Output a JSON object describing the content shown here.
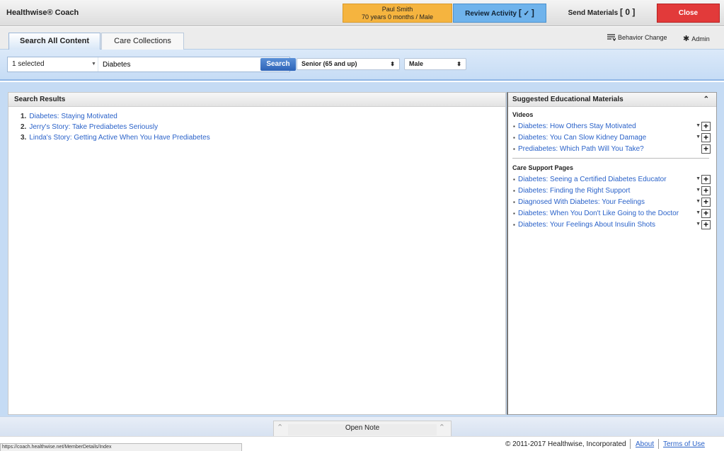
{
  "app": {
    "title": "Healthwise® Coach"
  },
  "patient": {
    "name": "Paul Smith",
    "details": "70 years 0 months / Male"
  },
  "header": {
    "review_label": "Review Activity",
    "review_bracket_open": "[",
    "review_check": "✓",
    "review_bracket_close": "]",
    "send_label": "Send Materials",
    "send_count": "[ 0 ]",
    "close_label": "Close",
    "colors": {
      "patient": "#f5b43f",
      "review": "#6fb3ec",
      "close": "#e23a3a"
    }
  },
  "tabs": [
    {
      "label": "Search All Content",
      "active": true
    },
    {
      "label": "Care Collections",
      "active": false
    }
  ],
  "header_links": {
    "behavior_change": "Behavior Change",
    "admin": "Admin"
  },
  "search": {
    "filter_value": "1 selected",
    "query": "Diabetes",
    "button": "Search",
    "age_group": "Senior (65 and up)",
    "sex": "Male"
  },
  "results": {
    "title": "Search Results",
    "items": [
      {
        "num": "1.",
        "title": "Diabetes: Staying Motivated"
      },
      {
        "num": "2.",
        "title": "Jerry's Story: Take Prediabetes Seriously"
      },
      {
        "num": "3.",
        "title": "Linda's Story: Getting Active When You Have Prediabetes"
      }
    ]
  },
  "suggested": {
    "title": "Suggested Educational Materials",
    "videos_title": "Videos",
    "videos": [
      "Diabetes: How Others Stay Motivated",
      "Diabetes: You Can Slow Kidney Damage",
      "Prediabetes: Which Path Will You Take?"
    ],
    "care_title": "Care Support Pages",
    "care_pages": [
      "Diabetes: Seeing a Certified Diabetes Educator",
      "Diabetes: Finding the Right Support",
      "Diagnosed With Diabetes: Your Feelings",
      "Diabetes: When You Don't Like Going to the Doctor",
      "Diabetes: Your Feelings About Insulin Shots"
    ]
  },
  "note": {
    "label": "Open Note"
  },
  "footer": {
    "status_url": "https://coach.healthwise.net/MemberDetails/Index",
    "copyright": "© 2011-2017 Healthwise, Incorporated",
    "about": "About",
    "terms": "Terms of Use"
  }
}
